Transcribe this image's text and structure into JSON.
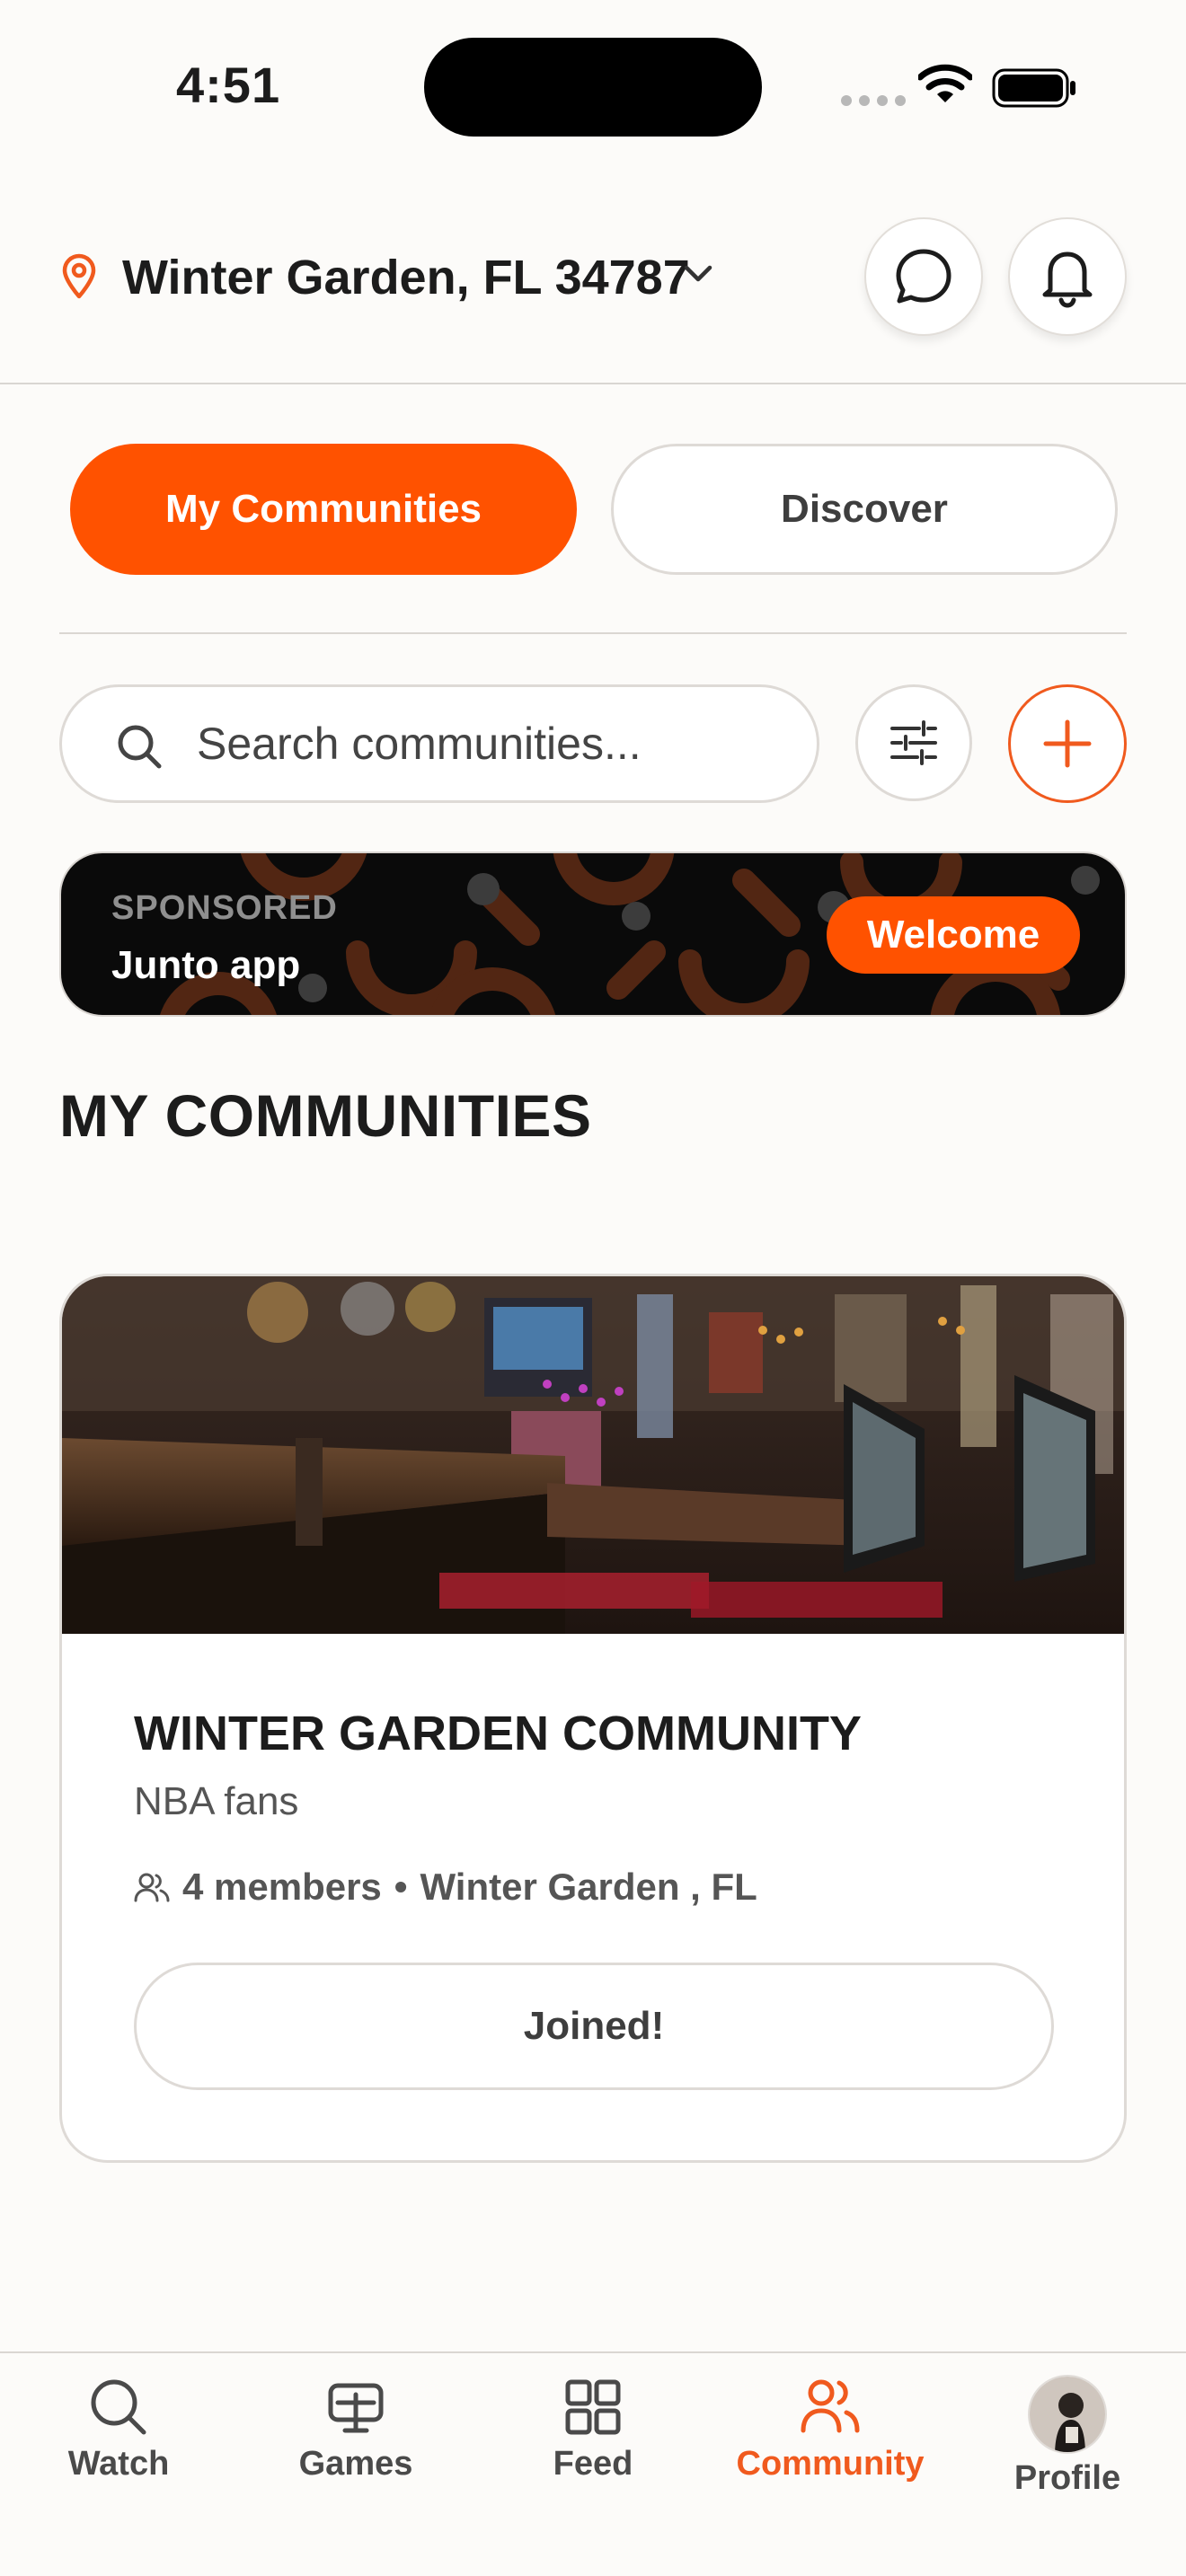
{
  "status_bar": {
    "time": "4:51"
  },
  "header": {
    "location": "Winter Garden, FL 34787"
  },
  "tabs": [
    {
      "label": "My Communities",
      "active": true
    },
    {
      "label": "Discover",
      "active": false
    }
  ],
  "search": {
    "placeholder": "Search communities..."
  },
  "sponsored": {
    "label": "SPONSORED",
    "title": "Junto app",
    "cta": "Welcome"
  },
  "section_title": "MY COMMUNITIES",
  "community": {
    "title": "WINTER GARDEN COMMUNITY",
    "subtitle": "NBA fans",
    "members": "4 members",
    "separator": "•",
    "location": "Winter Garden , FL",
    "button": "Joined!"
  },
  "tabbar": [
    {
      "label": "Watch",
      "icon": "search-icon"
    },
    {
      "label": "Games",
      "icon": "games-icon"
    },
    {
      "label": "Feed",
      "icon": "grid-icon"
    },
    {
      "label": "Community",
      "icon": "people-icon",
      "active": true
    },
    {
      "label": "Profile",
      "icon": "avatar"
    }
  ],
  "colors": {
    "accent": "#FF5200",
    "background": "#FCFBF9"
  }
}
